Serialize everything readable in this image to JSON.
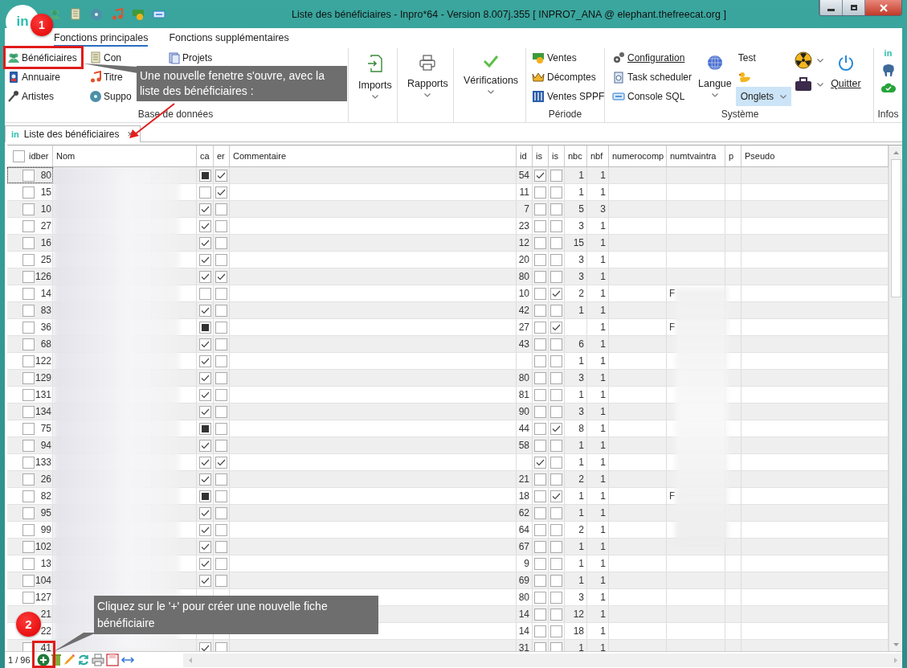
{
  "window": {
    "logo": "in",
    "title": "Liste des bénéficiaires - Inpro*64 - Version 8.007j.355  [ INPRO7_ANA @ elephant.thefreecat.org ]"
  },
  "ribbon_tabs": [
    {
      "label": "Fonctions principales",
      "selected": true
    },
    {
      "label": "Fonctions supplémentaires",
      "selected": false
    }
  ],
  "base_group": {
    "label": "Base de données",
    "columns": [
      [
        "Bénéficiaires",
        "Annuaire",
        "Artistes"
      ],
      [
        "Con",
        "Titre",
        "Suppo"
      ],
      [
        "Projets"
      ]
    ]
  },
  "large_buttons": [
    {
      "label": "Imports"
    },
    {
      "label": "Rapports"
    },
    {
      "label": "Vérifications"
    }
  ],
  "periode_group": {
    "label": "Période",
    "items": [
      "Ventes",
      "Décomptes",
      "Ventes SPPF"
    ]
  },
  "systeme_group": {
    "label": "Système",
    "items": [
      "Configuration",
      "Task scheduler",
      "Console SQL"
    ],
    "langue": "Langue",
    "test": "Test",
    "onglets": {
      "label": "Onglets",
      "highlighted": true
    },
    "quit": "Quitter"
  },
  "infos_group": {
    "label": "Infos",
    "logo": "in"
  },
  "doc_tab": {
    "logo": "in",
    "label": "Liste des bénéficiaires",
    "close": "×"
  },
  "table": {
    "all_selected": false,
    "columns": [
      "idber",
      "Nom",
      "ca",
      "er",
      "Commentaire",
      "id",
      "is",
      "is",
      "nbc",
      "nbf",
      "numerocomp",
      "numtvaintra",
      "p",
      "Pseudo"
    ],
    "rows": [
      {
        "idber": "80",
        "selected": false,
        "focused": true,
        "ca": false,
        "ca_mixed": true,
        "er": true,
        "id": "54",
        "is1": true,
        "is2": false,
        "nbc": "1",
        "nbf": "1"
      },
      {
        "idber": "15",
        "selected": false,
        "focused": false,
        "ca": false,
        "ca_mixed": false,
        "er": true,
        "id": "11",
        "is1": false,
        "is2": false,
        "nbc": "1",
        "nbf": "1"
      },
      {
        "idber": "10",
        "selected": false,
        "focused": false,
        "ca": true,
        "ca_mixed": false,
        "er": false,
        "id": "7",
        "is1": false,
        "is2": false,
        "nbc": "5",
        "nbf": "3"
      },
      {
        "idber": "27",
        "selected": false,
        "focused": false,
        "ca": true,
        "ca_mixed": false,
        "er": false,
        "id": "23",
        "is1": false,
        "is2": false,
        "nbc": "3",
        "nbf": "1"
      },
      {
        "idber": "16",
        "selected": false,
        "focused": false,
        "ca": true,
        "ca_mixed": false,
        "er": false,
        "id": "12",
        "is1": false,
        "is2": false,
        "nbc": "15",
        "nbf": "1"
      },
      {
        "idber": "25",
        "selected": false,
        "focused": false,
        "ca": true,
        "ca_mixed": false,
        "er": false,
        "id": "20",
        "is1": false,
        "is2": false,
        "nbc": "3",
        "nbf": "1"
      },
      {
        "idber": "126",
        "selected": false,
        "focused": false,
        "ca": true,
        "ca_mixed": false,
        "er": true,
        "id": "80",
        "is1": false,
        "is2": false,
        "nbc": "3",
        "nbf": "1"
      },
      {
        "idber": "14",
        "selected": false,
        "focused": false,
        "ca": false,
        "ca_mixed": false,
        "er": false,
        "id": "10",
        "is1": false,
        "is2": true,
        "nbc": "2",
        "nbf": "1",
        "numtva": "F"
      },
      {
        "idber": "83",
        "selected": false,
        "focused": false,
        "ca": true,
        "ca_mixed": false,
        "er": false,
        "id": "42",
        "is1": false,
        "is2": false,
        "nbc": "1",
        "nbf": "1"
      },
      {
        "idber": "36",
        "selected": false,
        "focused": false,
        "ca": false,
        "ca_mixed": true,
        "er": false,
        "id": "27",
        "is1": false,
        "is2": true,
        "nbf": "1",
        "numtva": "F"
      },
      {
        "idber": "68",
        "selected": false,
        "focused": false,
        "ca": true,
        "ca_mixed": false,
        "er": false,
        "id": "43",
        "is1": false,
        "is2": false,
        "nbc": "6",
        "nbf": "1"
      },
      {
        "idber": "122",
        "selected": false,
        "focused": false,
        "ca": true,
        "ca_mixed": false,
        "er": false,
        "is1": false,
        "is2": false,
        "nbc": "1",
        "nbf": "1"
      },
      {
        "idber": "129",
        "selected": false,
        "focused": false,
        "ca": true,
        "ca_mixed": false,
        "er": false,
        "id": "80",
        "is1": false,
        "is2": false,
        "nbc": "3",
        "nbf": "1"
      },
      {
        "idber": "131",
        "selected": false,
        "focused": false,
        "ca": true,
        "ca_mixed": false,
        "er": false,
        "id": "81",
        "is1": false,
        "is2": false,
        "nbc": "1",
        "nbf": "1"
      },
      {
        "idber": "134",
        "selected": false,
        "focused": false,
        "ca": true,
        "ca_mixed": false,
        "er": false,
        "id": "90",
        "is1": false,
        "is2": false,
        "nbc": "3",
        "nbf": "1"
      },
      {
        "idber": "75",
        "selected": false,
        "focused": false,
        "ca": false,
        "ca_mixed": true,
        "er": false,
        "id": "44",
        "is1": false,
        "is2": true,
        "nbc": "8",
        "nbf": "1"
      },
      {
        "idber": "94",
        "selected": false,
        "focused": false,
        "ca": true,
        "ca_mixed": false,
        "er": false,
        "id": "58",
        "is1": false,
        "is2": false,
        "nbc": "1",
        "nbf": "1"
      },
      {
        "idber": "133",
        "selected": false,
        "focused": false,
        "ca": true,
        "ca_mixed": false,
        "er": true,
        "is1": true,
        "is2": false,
        "nbc": "1",
        "nbf": "1"
      },
      {
        "idber": "26",
        "selected": false,
        "focused": false,
        "ca": true,
        "ca_mixed": false,
        "er": false,
        "id": "21",
        "is1": false,
        "is2": false,
        "nbc": "2",
        "nbf": "1"
      },
      {
        "idber": "82",
        "selected": false,
        "focused": false,
        "ca": false,
        "ca_mixed": true,
        "er": false,
        "id": "18",
        "is1": false,
        "is2": true,
        "nbc": "1",
        "nbf": "1",
        "numtva": "F"
      },
      {
        "idber": "95",
        "selected": false,
        "focused": false,
        "ca": true,
        "ca_mixed": false,
        "er": false,
        "id": "62",
        "is1": false,
        "is2": false,
        "nbc": "1",
        "nbf": "1"
      },
      {
        "idber": "99",
        "selected": false,
        "focused": false,
        "ca": true,
        "ca_mixed": false,
        "er": false,
        "id": "64",
        "is1": false,
        "is2": false,
        "nbc": "2",
        "nbf": "1"
      },
      {
        "idber": "102",
        "selected": false,
        "focused": false,
        "ca": true,
        "ca_mixed": false,
        "er": false,
        "id": "67",
        "is1": false,
        "is2": false,
        "nbc": "1",
        "nbf": "1"
      },
      {
        "idber": "13",
        "selected": false,
        "focused": false,
        "ca": true,
        "ca_mixed": false,
        "er": false,
        "id": "9",
        "is1": false,
        "is2": false,
        "nbc": "1",
        "nbf": "1"
      },
      {
        "idber": "104",
        "selected": false,
        "focused": false,
        "ca": true,
        "ca_mixed": false,
        "er": false,
        "id": "69",
        "is1": false,
        "is2": false,
        "nbc": "1",
        "nbf": "1"
      },
      {
        "idber": "127",
        "selected": false,
        "focused": false,
        "id": "80",
        "is1": false,
        "is2": false,
        "nbc": "3",
        "nbf": "1"
      },
      {
        "idber": "21",
        "focused": false,
        "id": "14",
        "is1": false,
        "is2": false,
        "nbc": "12",
        "nbf": "1"
      },
      {
        "idber": "22",
        "focused": false,
        "id": "14",
        "is1": false,
        "is2": false,
        "nbc": "18",
        "nbf": "1"
      },
      {
        "idber": "41",
        "selected": false,
        "focused": false,
        "ca": true,
        "ca_mixed": false,
        "er": false,
        "id": "31",
        "is1": false,
        "is2": false,
        "nbc": "1",
        "nbf": "1"
      }
    ]
  },
  "navigator": {
    "position": "1 / 96"
  },
  "callouts": [
    {
      "badge": "1",
      "text": "Une nouvelle fenetre s'ouvre, avec la liste des bénéficiaires :"
    },
    {
      "badge": "2",
      "text": "Cliquez sur le '+' pour créer une nouvelle fiche bénéficiaire"
    }
  ]
}
